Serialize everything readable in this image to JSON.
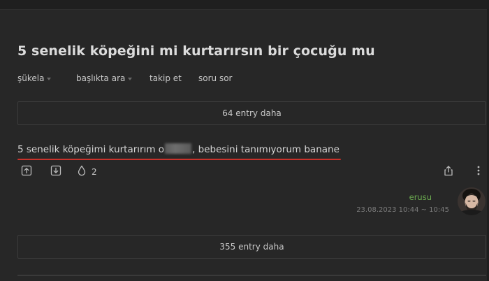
{
  "topic": {
    "title": "5 senelik köpeğini mi kurtarırsın bir çocuğu mu"
  },
  "subnav": {
    "items": [
      {
        "label": "şükela",
        "dropdown": true
      },
      {
        "label": "başlıkta ara",
        "dropdown": true
      },
      {
        "label": "takip et",
        "dropdown": false
      },
      {
        "label": "soru sor",
        "dropdown": false
      }
    ]
  },
  "more_entries_top": {
    "label": "64 entry daha"
  },
  "entry": {
    "text_before": "5 senelik köpeğimi kurtarırım o",
    "text_after": ", bebesini tanımıyorum banane",
    "favorite_count": "2",
    "author": "erusu",
    "date": "23.08.2023 10:44 ~ 10:45"
  },
  "more_entries_bottom": {
    "label": "355 entry daha"
  },
  "icons": {
    "upvote": "arrow-up-box-icon",
    "downvote": "arrow-down-box-icon",
    "favorite": "drop-icon",
    "share": "share-icon",
    "more": "ellipsis-icon"
  },
  "colors": {
    "background": "#272727",
    "author": "#6aa84f",
    "highlight_line": "#c8322b"
  }
}
